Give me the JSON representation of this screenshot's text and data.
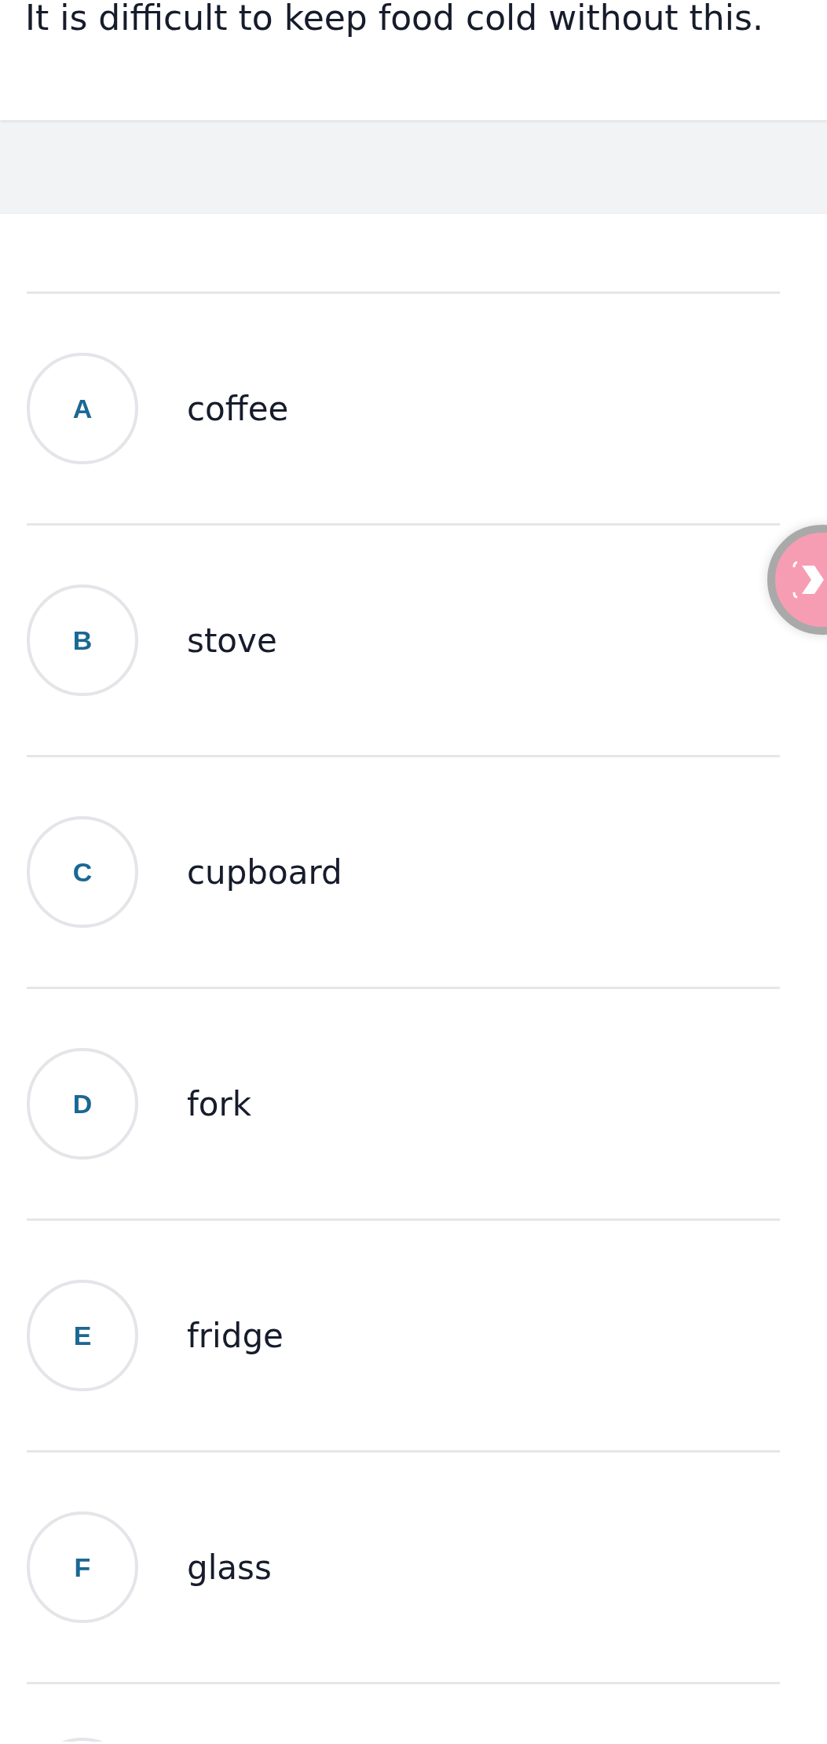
{
  "question": "It is difficult to keep food cold without this.",
  "options": [
    {
      "letter": "A",
      "text": "coffee"
    },
    {
      "letter": "B",
      "text": "stove"
    },
    {
      "letter": "C",
      "text": "cupboard"
    },
    {
      "letter": "D",
      "text": "fork"
    },
    {
      "letter": "E",
      "text": "fridge"
    },
    {
      "letter": "F",
      "text": "glass"
    }
  ],
  "more_options_below": true,
  "floating_button": {
    "visible": true
  }
}
